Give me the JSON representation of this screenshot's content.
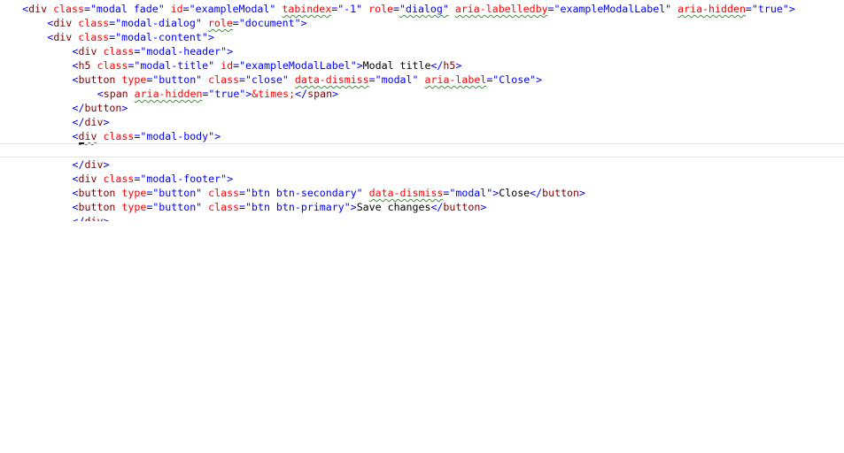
{
  "editor": {
    "lines": [
      {
        "indent": 3,
        "tokens": [
          {
            "t": "<",
            "c": "punct"
          },
          {
            "t": "div",
            "c": "tag"
          },
          {
            "t": " ",
            "c": "text"
          },
          {
            "t": "class",
            "c": "attr"
          },
          {
            "t": "=",
            "c": "punct"
          },
          {
            "t": "\"modal fade\"",
            "c": "str"
          },
          {
            "t": " ",
            "c": "text"
          },
          {
            "t": "id",
            "c": "attr"
          },
          {
            "t": "=",
            "c": "punct"
          },
          {
            "t": "\"exampleModal\"",
            "c": "str"
          },
          {
            "t": " ",
            "c": "text"
          },
          {
            "t": "tabindex",
            "c": "attr",
            "sq": true
          },
          {
            "t": "=",
            "c": "punct"
          },
          {
            "t": "\"-1\"",
            "c": "str"
          },
          {
            "t": " ",
            "c": "text"
          },
          {
            "t": "role",
            "c": "attr"
          },
          {
            "t": "=",
            "c": "punct"
          },
          {
            "t": "\"dialog\"",
            "c": "str",
            "sq": true
          },
          {
            "t": " ",
            "c": "text"
          },
          {
            "t": "aria-labelledby",
            "c": "attr",
            "sq": true
          },
          {
            "t": "=",
            "c": "punct"
          },
          {
            "t": "\"exampleModalLabel\"",
            "c": "str"
          },
          {
            "t": " ",
            "c": "text"
          },
          {
            "t": "aria-hidden",
            "c": "attr",
            "sq": true
          },
          {
            "t": "=",
            "c": "punct"
          },
          {
            "t": "\"true\"",
            "c": "str"
          },
          {
            "t": ">",
            "c": "punct"
          }
        ]
      },
      {
        "indent": 7,
        "tokens": [
          {
            "t": "<",
            "c": "punct"
          },
          {
            "t": "div",
            "c": "tag"
          },
          {
            "t": " ",
            "c": "text"
          },
          {
            "t": "class",
            "c": "attr"
          },
          {
            "t": "=",
            "c": "punct"
          },
          {
            "t": "\"modal-dialog\"",
            "c": "str"
          },
          {
            "t": " ",
            "c": "text"
          },
          {
            "t": "role",
            "c": "attr",
            "sq": true
          },
          {
            "t": "=",
            "c": "punct"
          },
          {
            "t": "\"document\"",
            "c": "str"
          },
          {
            "t": ">",
            "c": "punct"
          }
        ]
      },
      {
        "indent": 7,
        "tokens": [
          {
            "t": "<",
            "c": "punct"
          },
          {
            "t": "div",
            "c": "tag"
          },
          {
            "t": " ",
            "c": "text"
          },
          {
            "t": "class",
            "c": "attr"
          },
          {
            "t": "=",
            "c": "punct"
          },
          {
            "t": "\"modal-content\"",
            "c": "str"
          },
          {
            "t": ">",
            "c": "punct"
          }
        ]
      },
      {
        "indent": 11,
        "tokens": [
          {
            "t": "<",
            "c": "punct"
          },
          {
            "t": "div",
            "c": "tag"
          },
          {
            "t": " ",
            "c": "text"
          },
          {
            "t": "class",
            "c": "attr"
          },
          {
            "t": "=",
            "c": "punct"
          },
          {
            "t": "\"modal-header\"",
            "c": "str"
          },
          {
            "t": ">",
            "c": "punct"
          }
        ]
      },
      {
        "indent": 11,
        "tokens": [
          {
            "t": "<",
            "c": "punct"
          },
          {
            "t": "h5",
            "c": "tag"
          },
          {
            "t": " ",
            "c": "text"
          },
          {
            "t": "class",
            "c": "attr"
          },
          {
            "t": "=",
            "c": "punct"
          },
          {
            "t": "\"modal-title\"",
            "c": "str"
          },
          {
            "t": " ",
            "c": "text"
          },
          {
            "t": "id",
            "c": "attr"
          },
          {
            "t": "=",
            "c": "punct"
          },
          {
            "t": "\"exampleModalLabel\"",
            "c": "str"
          },
          {
            "t": ">",
            "c": "punct"
          },
          {
            "t": "Modal title",
            "c": "text"
          },
          {
            "t": "</",
            "c": "punct"
          },
          {
            "t": "h5",
            "c": "tag"
          },
          {
            "t": ">",
            "c": "punct"
          }
        ]
      },
      {
        "indent": 11,
        "tokens": [
          {
            "t": "<",
            "c": "punct"
          },
          {
            "t": "button",
            "c": "tag"
          },
          {
            "t": " ",
            "c": "text"
          },
          {
            "t": "type",
            "c": "attr"
          },
          {
            "t": "=",
            "c": "punct"
          },
          {
            "t": "\"button\"",
            "c": "str"
          },
          {
            "t": " ",
            "c": "text"
          },
          {
            "t": "class",
            "c": "attr"
          },
          {
            "t": "=",
            "c": "punct"
          },
          {
            "t": "\"close\"",
            "c": "str"
          },
          {
            "t": " ",
            "c": "text"
          },
          {
            "t": "data-dismiss",
            "c": "attr",
            "sq": true
          },
          {
            "t": "=",
            "c": "punct"
          },
          {
            "t": "\"modal\"",
            "c": "str"
          },
          {
            "t": " ",
            "c": "text"
          },
          {
            "t": "aria-label",
            "c": "attr",
            "sq": true
          },
          {
            "t": "=",
            "c": "punct"
          },
          {
            "t": "\"Close\"",
            "c": "str"
          },
          {
            "t": ">",
            "c": "punct"
          }
        ]
      },
      {
        "indent": 15,
        "tokens": [
          {
            "t": "<",
            "c": "punct"
          },
          {
            "t": "span",
            "c": "tag"
          },
          {
            "t": " ",
            "c": "text"
          },
          {
            "t": "aria-hidden",
            "c": "attr",
            "sq": true
          },
          {
            "t": "=",
            "c": "punct"
          },
          {
            "t": "\"true\"",
            "c": "str"
          },
          {
            "t": ">",
            "c": "punct"
          },
          {
            "t": "&times;",
            "c": "attr"
          },
          {
            "t": "</",
            "c": "punct"
          },
          {
            "t": "span",
            "c": "tag"
          },
          {
            "t": ">",
            "c": "punct"
          }
        ]
      },
      {
        "indent": 11,
        "tokens": [
          {
            "t": "</",
            "c": "punct"
          },
          {
            "t": "button",
            "c": "tag"
          },
          {
            "t": ">",
            "c": "punct"
          }
        ]
      },
      {
        "indent": 11,
        "tokens": [
          {
            "t": "</",
            "c": "punct"
          },
          {
            "t": "div",
            "c": "tag"
          },
          {
            "t": ">",
            "c": "punct"
          }
        ]
      },
      {
        "indent": 11,
        "tokens": [
          {
            "t": "<",
            "c": "punct"
          },
          {
            "t": "div",
            "c": "tag",
            "sq": true
          },
          {
            "t": " ",
            "c": "text"
          },
          {
            "t": "class",
            "c": "attr"
          },
          {
            "t": "=",
            "c": "punct"
          },
          {
            "t": "\"modal-body\"",
            "c": "str"
          },
          {
            "t": ">",
            "c": "punct"
          }
        ]
      },
      {
        "indent": 0,
        "current": true,
        "tokens": []
      },
      {
        "indent": 11,
        "tokens": [
          {
            "t": "</",
            "c": "punct"
          },
          {
            "t": "div",
            "c": "tag"
          },
          {
            "t": ">",
            "c": "punct"
          }
        ]
      },
      {
        "indent": 11,
        "tokens": [
          {
            "t": "<",
            "c": "punct"
          },
          {
            "t": "div",
            "c": "tag"
          },
          {
            "t": " ",
            "c": "text"
          },
          {
            "t": "class",
            "c": "attr"
          },
          {
            "t": "=",
            "c": "punct"
          },
          {
            "t": "\"modal-footer\"",
            "c": "str"
          },
          {
            "t": ">",
            "c": "punct"
          }
        ]
      },
      {
        "indent": 11,
        "tokens": [
          {
            "t": "<",
            "c": "punct"
          },
          {
            "t": "button",
            "c": "tag"
          },
          {
            "t": " ",
            "c": "text"
          },
          {
            "t": "type",
            "c": "attr"
          },
          {
            "t": "=",
            "c": "punct"
          },
          {
            "t": "\"button\"",
            "c": "str"
          },
          {
            "t": " ",
            "c": "text"
          },
          {
            "t": "class",
            "c": "attr"
          },
          {
            "t": "=",
            "c": "punct"
          },
          {
            "t": "\"btn btn-secondary\"",
            "c": "str"
          },
          {
            "t": " ",
            "c": "text"
          },
          {
            "t": "data-dismiss",
            "c": "attr",
            "sq": true
          },
          {
            "t": "=",
            "c": "punct"
          },
          {
            "t": "\"modal\"",
            "c": "str"
          },
          {
            "t": ">",
            "c": "punct"
          },
          {
            "t": "Close",
            "c": "text"
          },
          {
            "t": "</",
            "c": "punct"
          },
          {
            "t": "button",
            "c": "tag"
          },
          {
            "t": ">",
            "c": "punct"
          }
        ]
      },
      {
        "indent": 11,
        "tokens": [
          {
            "t": "<",
            "c": "punct"
          },
          {
            "t": "button",
            "c": "tag"
          },
          {
            "t": " ",
            "c": "text"
          },
          {
            "t": "type",
            "c": "attr"
          },
          {
            "t": "=",
            "c": "punct"
          },
          {
            "t": "\"button\"",
            "c": "str"
          },
          {
            "t": " ",
            "c": "text"
          },
          {
            "t": "class",
            "c": "attr"
          },
          {
            "t": "=",
            "c": "punct"
          },
          {
            "t": "\"btn btn-primary\"",
            "c": "str"
          },
          {
            "t": ">",
            "c": "punct"
          },
          {
            "t": "Save changes",
            "c": "text"
          },
          {
            "t": "</",
            "c": "punct"
          },
          {
            "t": "button",
            "c": "tag"
          },
          {
            "t": ">",
            "c": "punct"
          }
        ]
      },
      {
        "indent": 11,
        "partial": true,
        "tokens": [
          {
            "t": "</",
            "c": "punct"
          },
          {
            "t": "div",
            "c": "tag"
          },
          {
            "t": ">",
            "c": "punct"
          }
        ]
      }
    ]
  },
  "colors": {
    "tag": "#800000",
    "attribute": "#ff0000",
    "string": "#0000ff",
    "text": "#000000",
    "squiggle": "#2e9e2e",
    "current_line_border": "#e4e4e4"
  }
}
